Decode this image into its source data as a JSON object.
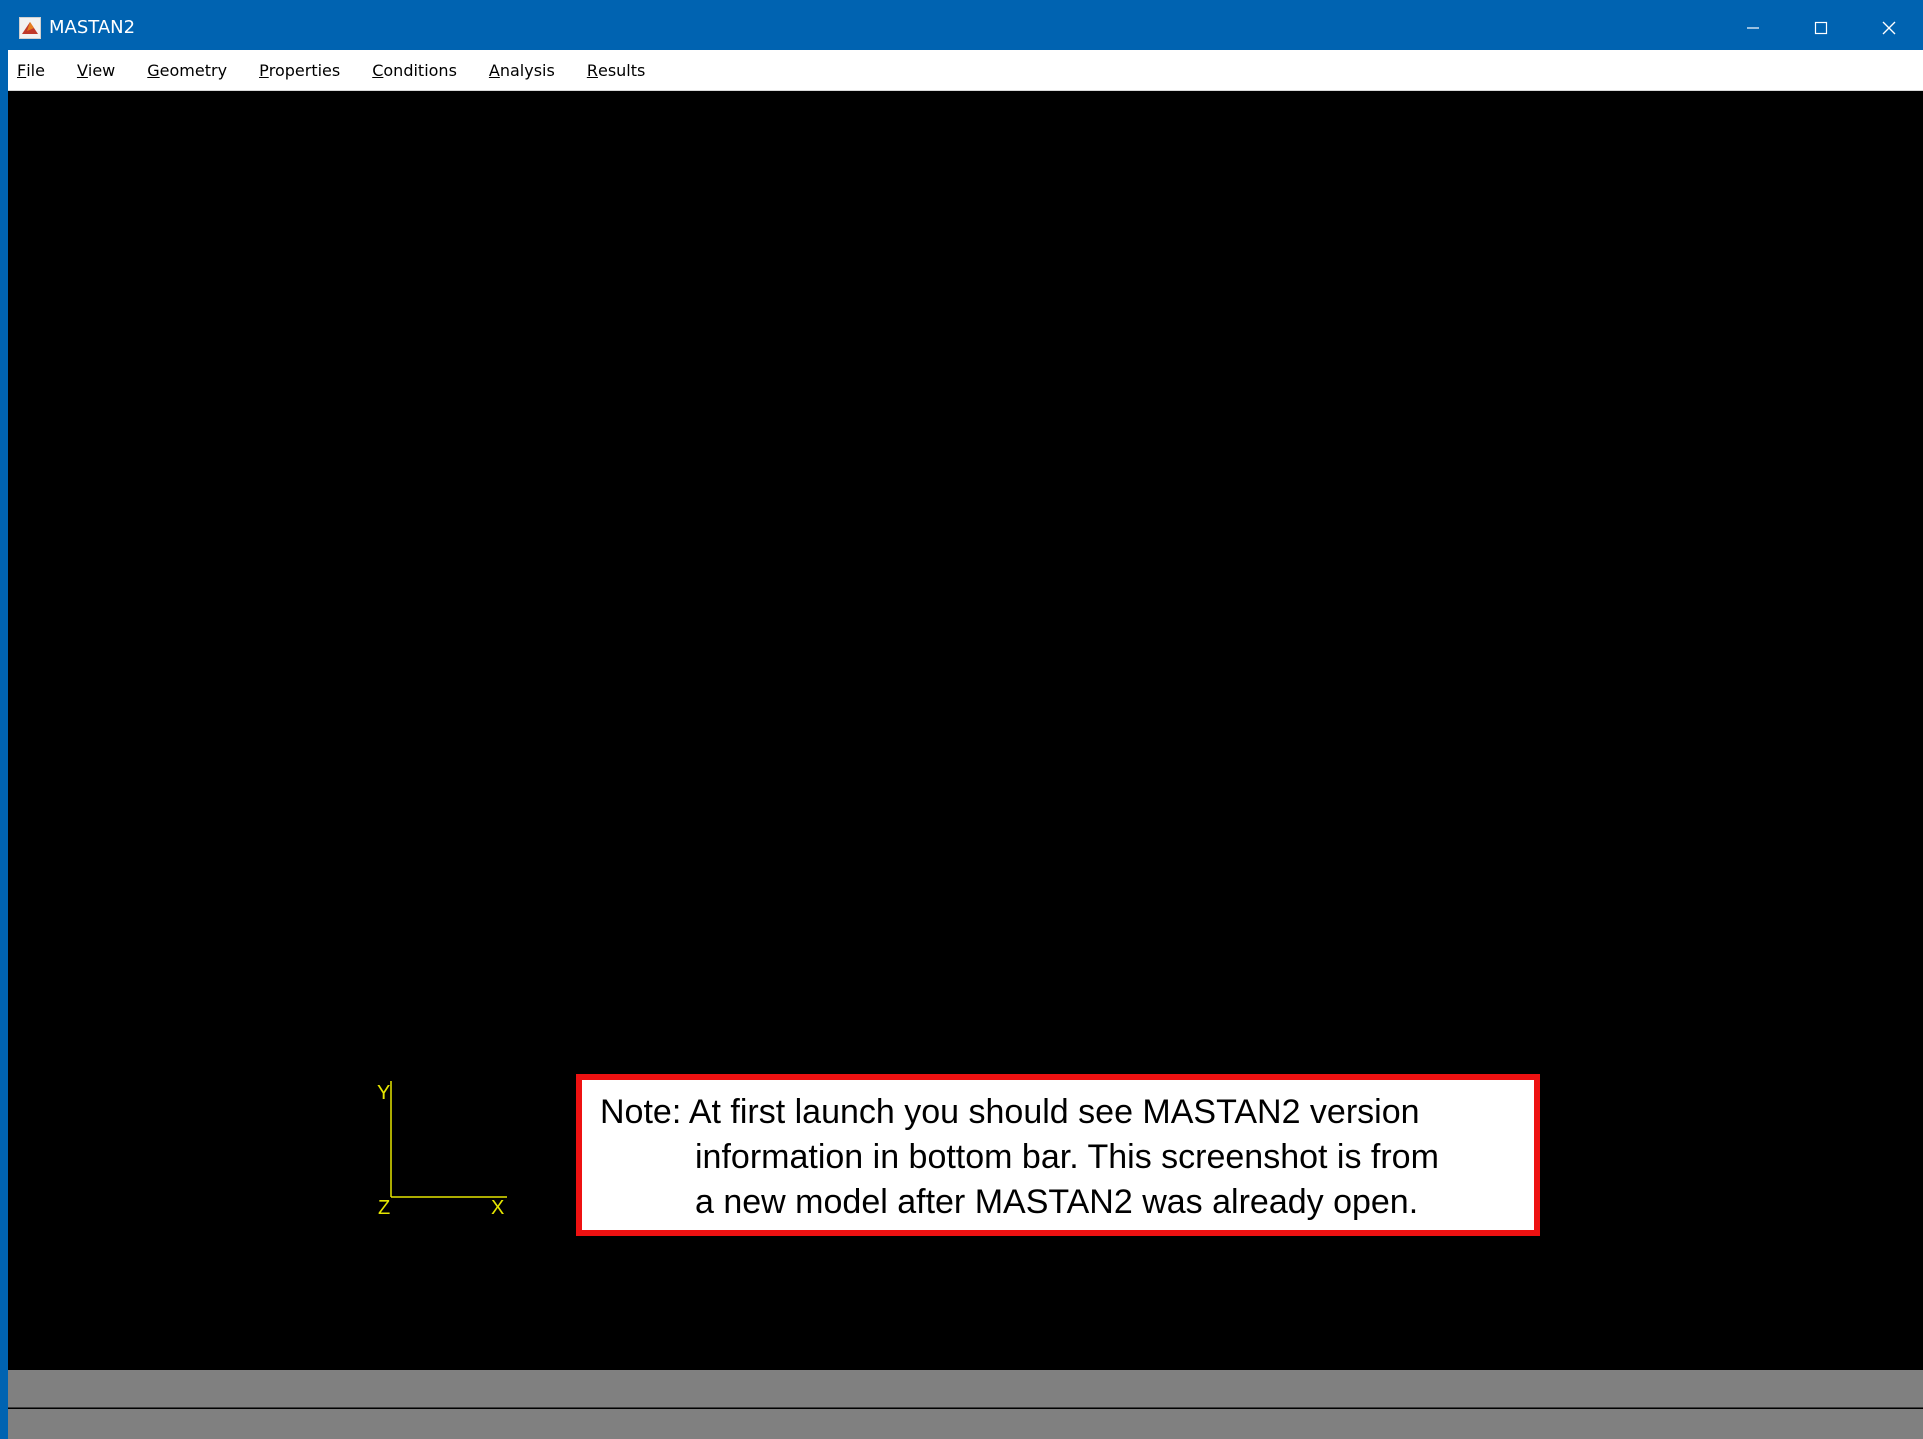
{
  "window": {
    "title": "MASTAN2",
    "icon": "matlab-icon",
    "accent": "#0063b1",
    "controls": [
      "minimize-icon",
      "maximize-icon",
      "close-icon"
    ]
  },
  "menubar": {
    "items": [
      {
        "accel": "F",
        "rest": "ile"
      },
      {
        "accel": "V",
        "rest": "iew"
      },
      {
        "accel": "G",
        "rest": "eometry"
      },
      {
        "accel": "P",
        "rest": "roperties"
      },
      {
        "accel": "C",
        "rest": "onditions"
      },
      {
        "accel": "A",
        "rest": "nalysis"
      },
      {
        "accel": "R",
        "rest": "esults"
      }
    ]
  },
  "axes_triad": {
    "y_label": "Y",
    "z_label": "Z",
    "x_label": "X",
    "color": "#e6e600"
  },
  "note": {
    "line1": "Note: At first launch you should see MASTAN2 version",
    "line2": "information in bottom bar. This screenshot is from",
    "line3": "a new model after MASTAN2 was already open.",
    "border_color": "#ee1111"
  },
  "statusbar": {
    "color": "#808080"
  }
}
